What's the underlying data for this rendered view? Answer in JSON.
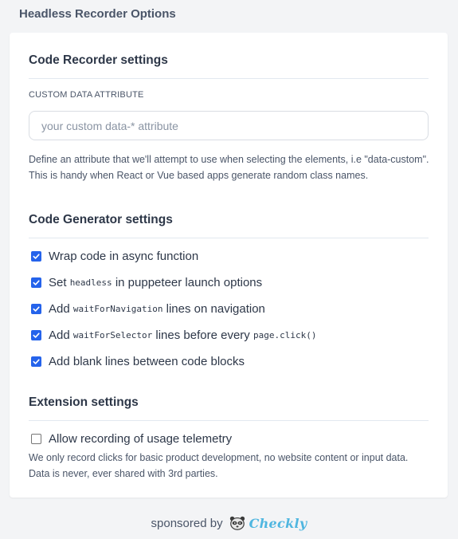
{
  "app": {
    "title": "Headless Recorder Options"
  },
  "code_recorder": {
    "title": "Code Recorder settings",
    "field_label": "CUSTOM DATA ATTRIBUTE",
    "input_value": "",
    "input_placeholder": "your custom data-* attribute",
    "help_text": "Define an attribute that we'll attempt to use when selecting the elements, i.e \"data-custom\". This is handy when React or Vue based apps generate random class names."
  },
  "code_generator": {
    "title": "Code Generator settings",
    "options": [
      {
        "checked": true,
        "label": "Wrap code in async function"
      },
      {
        "checked": true,
        "prefix": "Set",
        "code": "headless",
        "suffix": "in puppeteer launch options"
      },
      {
        "checked": true,
        "prefix": "Add",
        "code": "waitForNavigation",
        "suffix": "lines on navigation"
      },
      {
        "checked": true,
        "prefix": "Add",
        "code": "waitForSelector",
        "suffix": "lines before every",
        "code2": "page.click()"
      },
      {
        "checked": true,
        "label": "Add blank lines between code blocks"
      }
    ]
  },
  "extension": {
    "title": "Extension settings",
    "telemetry": {
      "checked": false,
      "label": "Allow recording of usage telemetry"
    },
    "help_text": "We only record clicks for basic product development, no website content or input data. Data is never, ever shared with 3rd parties."
  },
  "footer": {
    "sponsored_text": "sponsored by",
    "brand": "Checkly",
    "logo_icon": "raccoon-logo-icon"
  },
  "colors": {
    "checkbox_accent": "#2563eb",
    "brand": "#4fb6e0",
    "page_background": "#f3f4f6"
  }
}
